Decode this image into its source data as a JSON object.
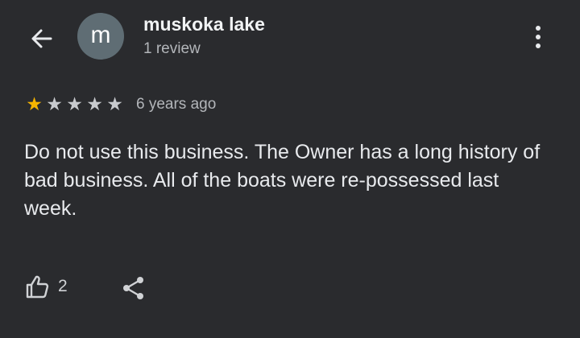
{
  "header": {
    "back_icon": "arrow-left-icon",
    "avatar_letter": "m",
    "reviewer_name": "muskoka lake",
    "review_count": "1 review",
    "more_icon": "more-vertical-icon"
  },
  "review": {
    "rating": 1,
    "rating_max": 5,
    "star_color": "#f5b400",
    "date": "6 years ago",
    "text": "Do not use this business. The Owner has a long history of bad business. All of the boats were re-possessed last week."
  },
  "actions": {
    "like_icon": "thumbs-up-icon",
    "like_count": "2",
    "share_icon": "share-icon"
  },
  "colors": {
    "background": "#2a2b2e",
    "avatar_bg": "#5f6d74"
  }
}
